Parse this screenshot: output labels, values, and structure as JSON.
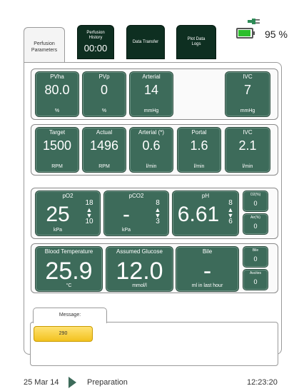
{
  "tabs": {
    "perfusion_parameters": "Perfusion\nParameters",
    "perfusion_history": {
      "label": "Perfusion\nHistory",
      "time": "00:00"
    },
    "data_transfer": "Data Transfer",
    "plot_data_logs": "Plot Data\nLogs"
  },
  "battery": {
    "percent": "95 %",
    "level": 0.95
  },
  "pressures": [
    {
      "label": "PVha",
      "value": "80.0",
      "unit": "%"
    },
    {
      "label": "PVp",
      "value": "0",
      "unit": "%"
    },
    {
      "label": "Arterial",
      "value": "14",
      "unit": "mmHg"
    },
    {
      "label": "IVC",
      "value": "7",
      "unit": "mmHg"
    }
  ],
  "flows": [
    {
      "label": "Target",
      "value": "1500",
      "unit": "RPM"
    },
    {
      "label": "Actual",
      "value": "1496",
      "unit": "RPM"
    },
    {
      "label": "Arterial (*)",
      "value": "0.6",
      "unit": "l/min"
    },
    {
      "label": "Portal",
      "value": "1.6",
      "unit": "l/min"
    },
    {
      "label": "IVC",
      "value": "2.1",
      "unit": "l/min"
    }
  ],
  "gases": {
    "po2": {
      "label": "pO2",
      "value": "25",
      "unit": "kPa",
      "high": "18",
      "low": "10"
    },
    "pco2": {
      "label": "pCO2",
      "value": "-",
      "unit": "kPa",
      "high": "8",
      "low": "3"
    },
    "ph": {
      "label": "pH",
      "value": "6.61",
      "high": "8",
      "low": "6"
    },
    "o2": {
      "label": "O2(%)",
      "value": "0"
    },
    "air": {
      "label": "Air(%)",
      "value": "0"
    }
  },
  "metabolics": {
    "temperature": {
      "label": "Blood Temperature",
      "value": "25.9",
      "unit": "°C"
    },
    "glucose": {
      "label": "Assumed Glucose",
      "value": "12.0",
      "unit": "mmol/l"
    },
    "bile": {
      "label": "Bile",
      "value": "-",
      "unit": "ml in last hour"
    },
    "bile_small": {
      "label": "Bile",
      "value": "0"
    },
    "ascites": {
      "label": "Ascites",
      "value": "0"
    }
  },
  "message": {
    "tab_label": "Message:",
    "alarm_code": "290"
  },
  "status": {
    "date": "25 Mar 14",
    "state": "Preparation",
    "time": "12:23:20"
  },
  "colors": {
    "tile": "#3d6b5a",
    "tab_dark": "#0e2f21",
    "alarm": "#f2c21f",
    "battery": "#2bbf2b"
  },
  "icons": [
    "plug-icon",
    "battery-icon",
    "play-icon",
    "up-down-arrows-icon"
  ]
}
